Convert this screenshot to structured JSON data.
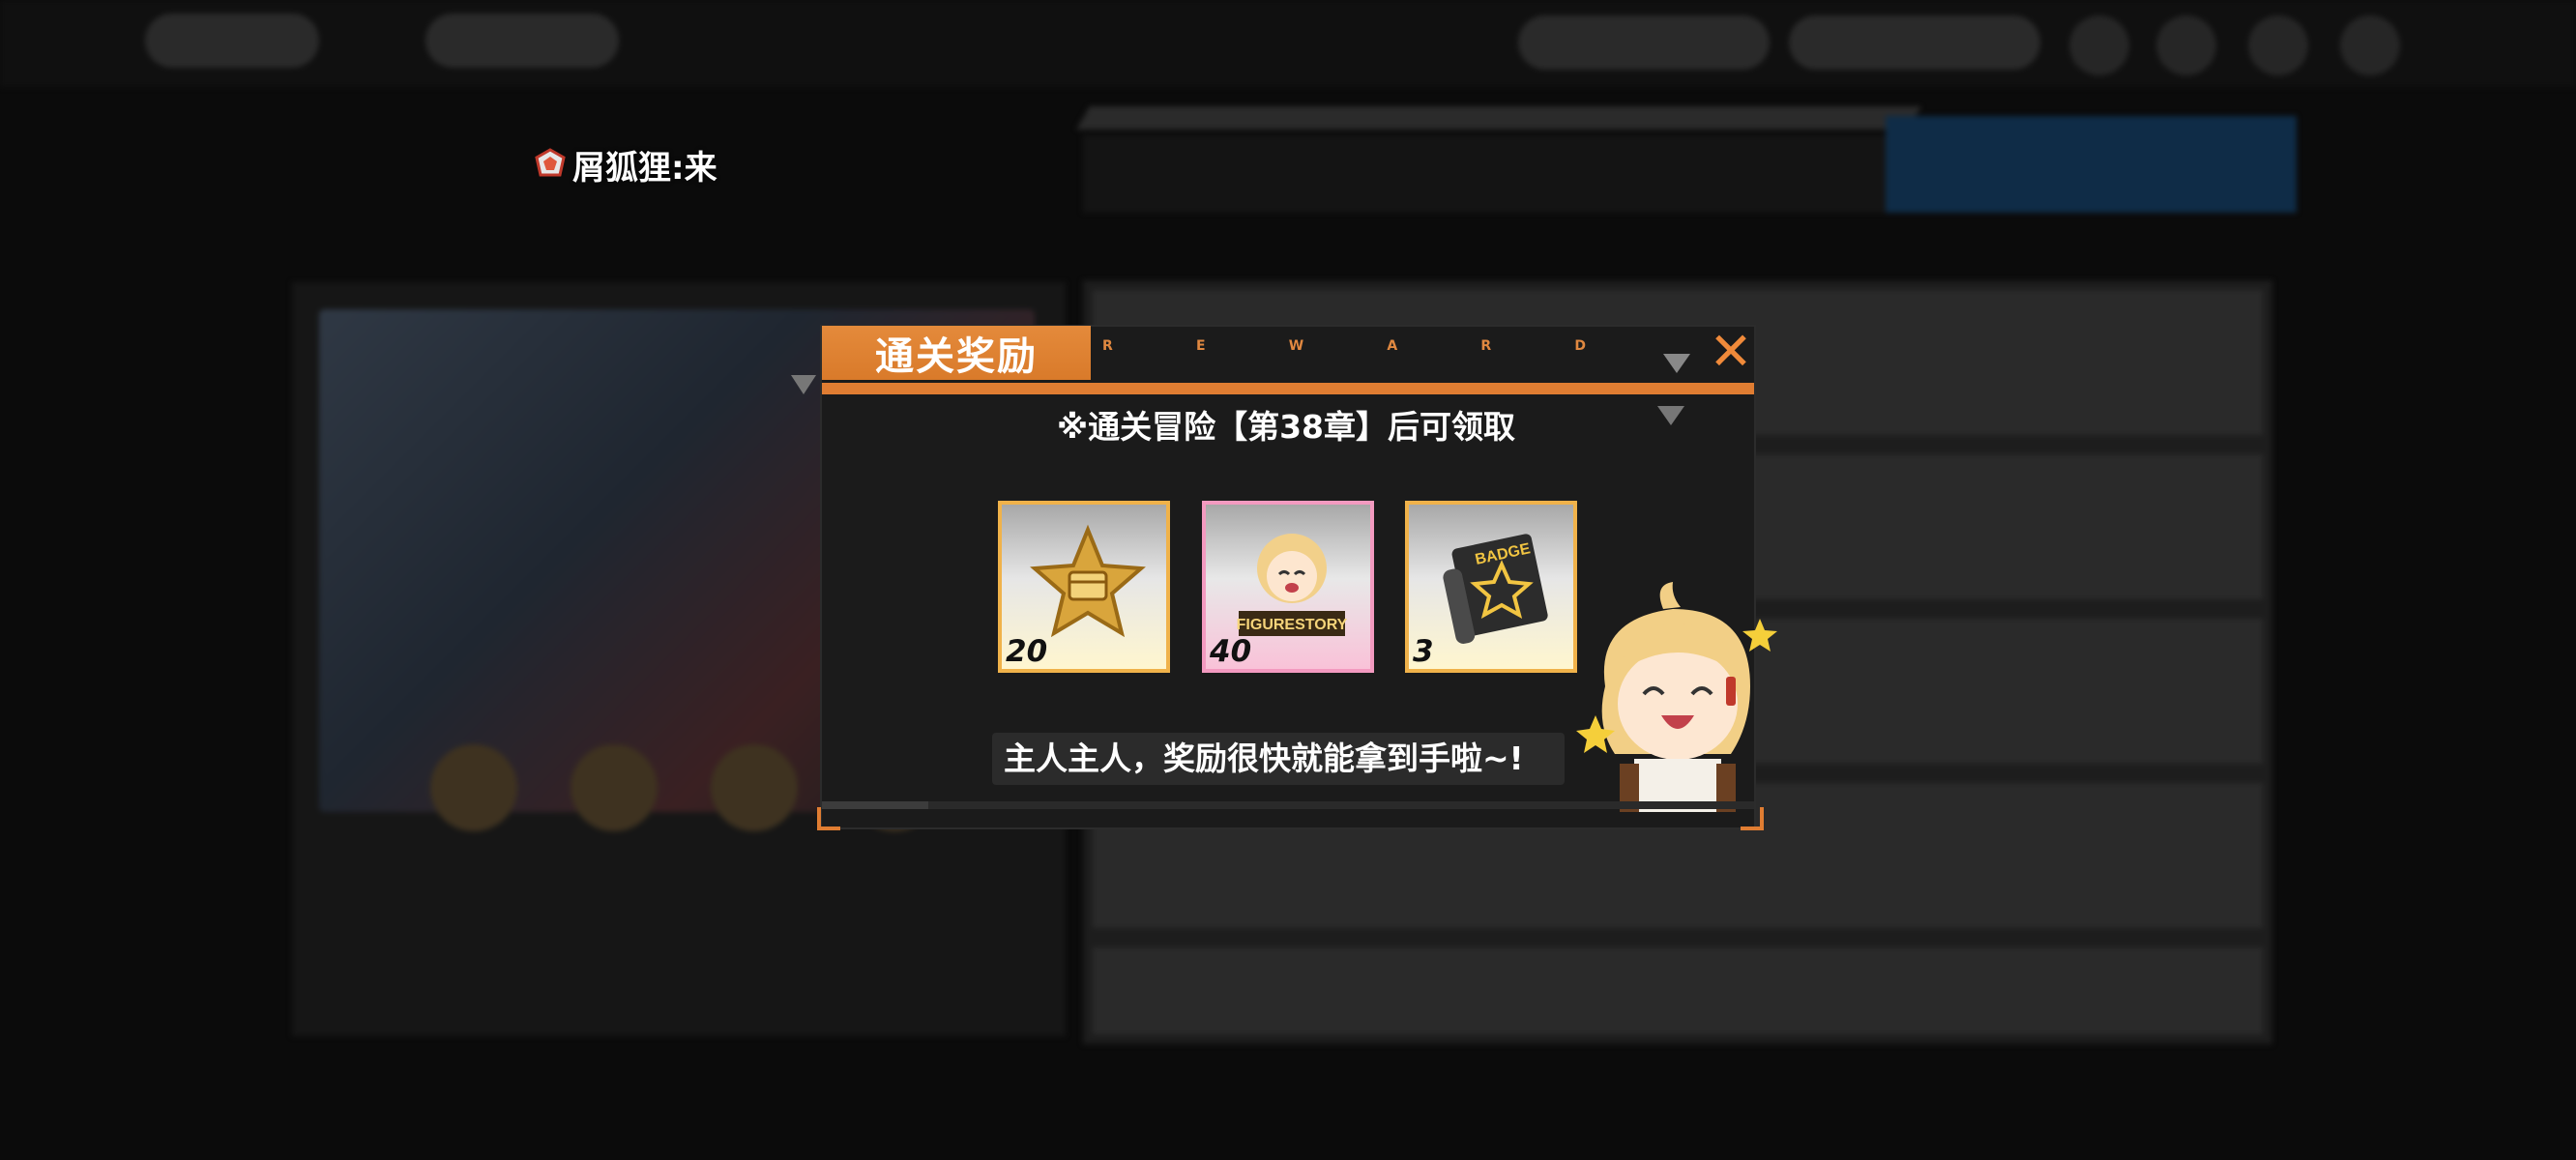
{
  "header": {
    "player_name": "屑狐狸:来",
    "rank_icon": "rank-badge-icon"
  },
  "dialog": {
    "title": "通关奖励",
    "reward_letters": [
      "R",
      "E",
      "W",
      "A",
      "R",
      "D"
    ],
    "close_label": "✕",
    "notice": "※通关冒险【第38章】后可领取",
    "rewards": [
      {
        "icon": "star-chest-token-icon",
        "count": "20",
        "frame": "gold"
      },
      {
        "icon": "figurestory-character-icon",
        "count": "40",
        "frame": "pink"
      },
      {
        "icon": "badge-scroll-icon",
        "count": "3",
        "frame": "gold"
      }
    ],
    "speech": "主人主人，奖励很快就能拿到手啦~!",
    "accent_color": "#e07d32"
  },
  "item_labels": {
    "figurestory": "FIGURESTORY",
    "badge": "BADGE"
  }
}
